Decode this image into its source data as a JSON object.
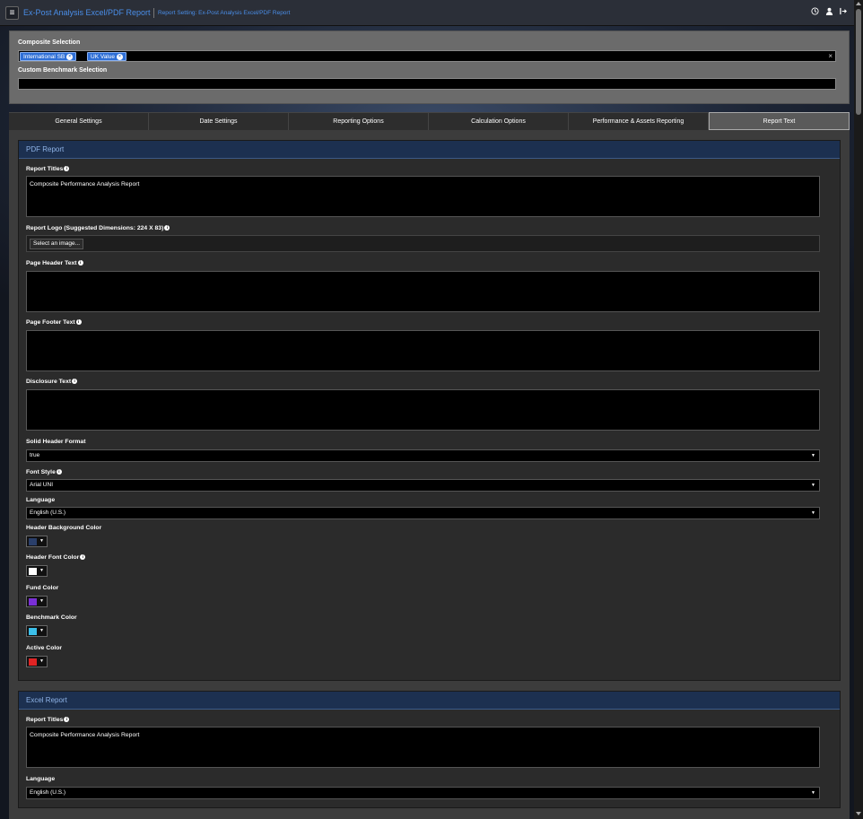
{
  "app": {
    "title": "Ex-Post Analysis Excel/PDF Report",
    "breadcrumb": "Report Setting: Ex-Post Analysis Excel/PDF Report"
  },
  "icons": {
    "menu": "hamburger-menu-icon",
    "history": "clock-icon",
    "user": "user-icon",
    "logout": "sign-out-icon"
  },
  "selection": {
    "composite_label": "Composite Selection",
    "composite_tags": [
      "International SB",
      "UK Value"
    ],
    "benchmark_label": "Custom Benchmark Selection"
  },
  "tabs": [
    {
      "label": "General Settings",
      "active": false
    },
    {
      "label": "Date Settings",
      "active": false
    },
    {
      "label": "Reporting Options",
      "active": false
    },
    {
      "label": "Calculation Options",
      "active": false
    },
    {
      "label": "Performance & Assets Reporting",
      "active": false
    },
    {
      "label": "Report Text",
      "active": true
    }
  ],
  "pdf": {
    "header": "PDF Report",
    "titles_label": "Report Titles",
    "titles_value": "Composite Performance Analysis Report",
    "logo_label": "Report Logo (Suggested Dimensions: 224 X 83)",
    "logo_button": "Select an image...",
    "page_header_label": "Page Header Text",
    "page_footer_label": "Page Footer Text",
    "disclosure_label": "Disclosure Text",
    "solid_header_label": "Solid Header Format",
    "solid_header_value": "true",
    "font_style_label": "Font Style",
    "font_style_value": "Arial UNI",
    "language_label": "Language",
    "language_value": "English (U.S.)",
    "header_bg_label": "Header Background Color",
    "header_bg_color": "#2a3f6a",
    "header_font_label": "Header Font Color",
    "header_font_color": "#ffffff",
    "fund_label": "Fund Color",
    "fund_color": "#7a2fd6",
    "benchmark_label": "Benchmark Color",
    "benchmark_color": "#3cc0ea",
    "active_label": "Active Color",
    "active_color": "#e02424"
  },
  "excel": {
    "header": "Excel Report",
    "titles_label": "Report Titles",
    "titles_value": "Composite Performance Analysis Report",
    "language_label": "Language",
    "language_value": "English (U.S.)"
  }
}
